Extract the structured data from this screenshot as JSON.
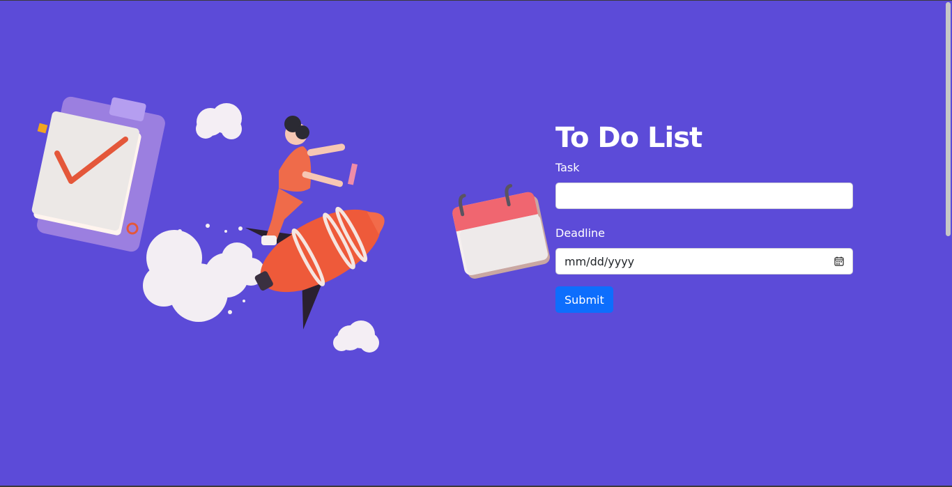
{
  "form": {
    "title": "To Do List",
    "task_label": "Task",
    "task_value": "",
    "deadline_label": "Deadline",
    "deadline_placeholder": "mm/dd/yyyy",
    "submit_label": "Submit"
  },
  "colors": {
    "background": "#5c4bd8",
    "submit_button": "#0d6efd",
    "text": "#ffffff"
  },
  "icons": [
    "calendar-picker-icon",
    "clipboard-checkmark-illustration",
    "rocket-rider-illustration",
    "calendar-illustration"
  ]
}
